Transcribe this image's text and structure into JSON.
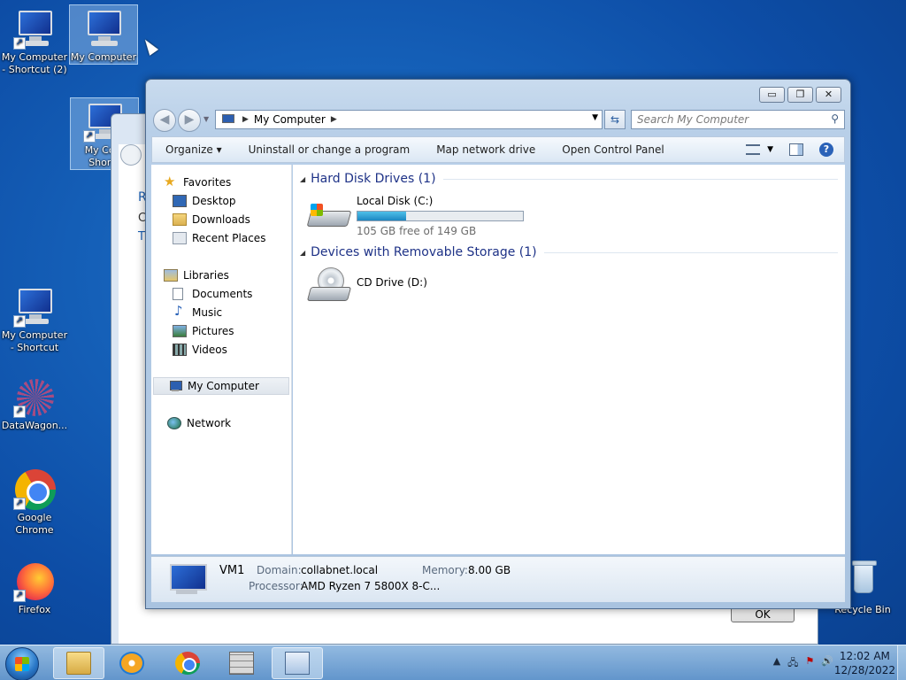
{
  "desktop": {
    "icons": [
      {
        "label": "My Computer - Shortcut (2)"
      },
      {
        "label": "My Computer"
      },
      {
        "label": "My Computer - Shortcut"
      },
      {
        "label": "DataWagon..."
      },
      {
        "label": "Google Chrome"
      },
      {
        "label": "Firefox"
      },
      {
        "label": "Recycle Bin"
      }
    ],
    "partial_icon_label": "My Com Shortc"
  },
  "background_dialog": {
    "glyphs": [
      "R",
      "C",
      "T"
    ],
    "ok_label": "OK"
  },
  "window": {
    "caption_buttons": {
      "minimize": "▭",
      "maximize": "❐",
      "close": "✕"
    },
    "address": {
      "crumb": "My Computer"
    },
    "search": {
      "placeholder": "Search My Computer"
    },
    "commands": {
      "organize": "Organize ▾",
      "uninstall": "Uninstall or change a program",
      "map_drive": "Map network drive",
      "control_panel": "Open Control Panel"
    },
    "nav": {
      "favorites": "Favorites",
      "desktop": "Desktop",
      "downloads": "Downloads",
      "recent": "Recent Places",
      "libraries": "Libraries",
      "documents": "Documents",
      "music": "Music",
      "pictures": "Pictures",
      "videos": "Videos",
      "computer": "My Computer",
      "network": "Network"
    },
    "groups": {
      "hdd": {
        "title": "Hard Disk Drives (1)",
        "drive_name": "Local Disk (C:)",
        "free_text": "105 GB free of 149 GB",
        "used_fraction": 0.295
      },
      "removable": {
        "title": "Devices with Removable Storage (1)",
        "drive_name": "CD Drive (D:)"
      }
    },
    "details": {
      "computer_name": "VM1",
      "domain_label": "Domain:",
      "domain_value": "collabnet.local",
      "memory_label": "Memory:",
      "memory_value": "8.00 GB",
      "processor_label": "Processor:",
      "processor_value": "AMD Ryzen 7 5800X 8-C..."
    }
  },
  "taskbar": {
    "time": "12:02 AM",
    "date": "12/28/2022"
  }
}
